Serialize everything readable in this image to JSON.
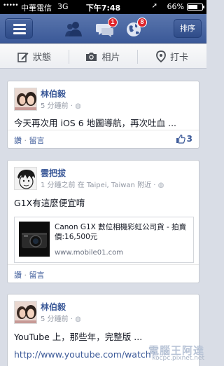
{
  "status_bar": {
    "signal": "•••••",
    "carrier": "中華電信",
    "network": "3G",
    "time": "下午7:48",
    "location_arrow": "➚",
    "battery_percent": "66%",
    "battery_level": 0.66
  },
  "nav": {
    "menu_icon": "hamburger-menu-icon",
    "friends_icon": "friend-requests-icon",
    "messages_icon": "messages-icon",
    "messages_badge": "1",
    "notifications_icon": "globe-icon",
    "notifications_badge": "8",
    "right_button": "排序",
    "brand_color": "#3b5998",
    "badge_color": "#e0252b"
  },
  "actions": {
    "status": "狀態",
    "photo": "相片",
    "checkin": "打卡"
  },
  "posts": [
    {
      "author": "林伯毅",
      "time": "5 分鐘前 ·",
      "text": "今天再次用 iOS 6 地圖導航，再次吐血 ...",
      "read_link": "讚",
      "comment_link": "留言",
      "likes": "3"
    },
    {
      "author": "雲把拔",
      "time": "1 分鐘之前 在 Taipei, Taiwan 附近 ·",
      "text": "G1X有這麼便宜唷",
      "link_title": "Canon G1X 數位相機彩虹公司貨 - 拍賣價:16,500元",
      "link_url": "www.mobile01.com",
      "read_link": "讚",
      "comment_link": "留言"
    },
    {
      "author": "林伯毅",
      "time": "5 分鐘前 ·",
      "text": "YouTube 上，那些年，完整版 ...",
      "url_line": "http://www.youtube.com/watch?"
    }
  ],
  "watermark": {
    "title": "電腦王阿達",
    "site": "kocpc.pixnet.net"
  }
}
